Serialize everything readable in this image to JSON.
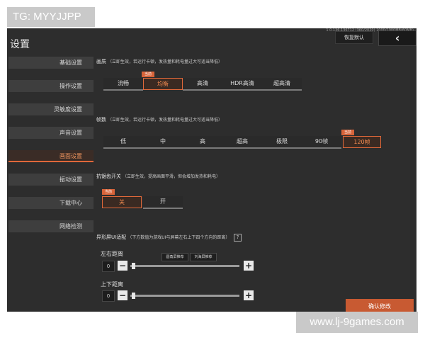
{
  "watermarks": {
    "top": "TG: MYYJJPP",
    "bottom": "www.lj-9games.com"
  },
  "header": {
    "title": "设置",
    "version": "1.0.136.136712 (360/2020) 1000/1000MB(60MB)",
    "reset_label": "恢复默认",
    "back_icon": "‹"
  },
  "sidebar": {
    "items": [
      {
        "label": "基础设置"
      },
      {
        "label": "操作设置"
      },
      {
        "label": "灵敏度设置"
      },
      {
        "label": "声音设置"
      },
      {
        "label": "画面设置"
      },
      {
        "label": "振动设置"
      },
      {
        "label": "下载中心"
      },
      {
        "label": "网络检测"
      }
    ],
    "active_index": 4
  },
  "quality": {
    "label": "画质",
    "hint": "（立即生效，若运行卡顿，发热量和耗电量过大可适当降低）",
    "badge": "当前",
    "options": [
      "流畅",
      "均衡",
      "高清",
      "HDR高清",
      "超高清"
    ],
    "selected_index": 1
  },
  "framerate": {
    "label": "帧数",
    "hint": "（立即生效，若运行卡顿，发热量和耗电量过大可适当降低）",
    "badge": "当前",
    "options": [
      "低",
      "中",
      "高",
      "超高",
      "极限",
      "90帧",
      "120帧"
    ],
    "selected_index": 6
  },
  "antialias": {
    "label": "抗锯齿开关",
    "hint": "（立即生效，提高画面平滑，但会增加发热和耗电）",
    "badge": "当前",
    "options": [
      "关",
      "开"
    ],
    "selected_index": 0
  },
  "notch": {
    "label": "异形屏UI适配",
    "hint": "（下方数值为游戏UI与屏幕左右上下四个方向的距离）",
    "help": "?",
    "preset_round": "圆角屏推荐",
    "preset_notch": "刘海屏推荐",
    "lr_label": "左右距离",
    "lr_value": "0",
    "ud_label": "上下距离",
    "ud_value": "0",
    "minus": "−",
    "plus": "+"
  },
  "confirm_label": "确认修改",
  "colors": {
    "accent": "#e0683a",
    "panel": "#2d2d2d",
    "sidebar": "#3e3e3e"
  }
}
